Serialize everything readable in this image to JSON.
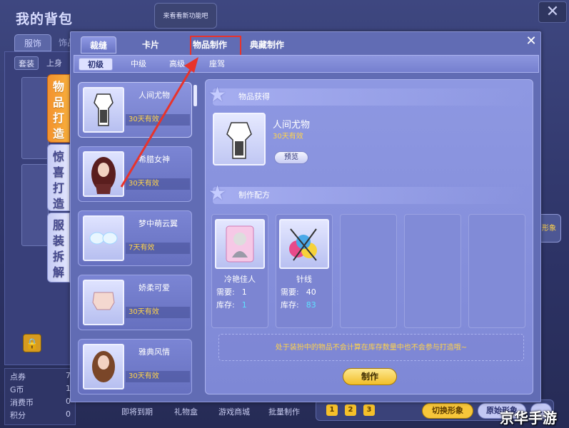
{
  "bag": {
    "title": "我的背包",
    "top_banner": "来看看新功能吧",
    "close": "✕",
    "tabs": [
      "服饰",
      "饰品"
    ],
    "subtabs": [
      "套装",
      "上身"
    ],
    "lock_icon": "lock-icon",
    "stats": [
      {
        "label": "点券",
        "value": "7"
      },
      {
        "label": "G币",
        "value": "1"
      },
      {
        "label": "消费币",
        "value": "0"
      },
      {
        "label": "积分",
        "value": "0"
      }
    ],
    "bottom_links": [
      "即将到期",
      "礼物盒",
      "游戏商城",
      "批量制作"
    ],
    "side_button": "形象",
    "toolbar": {
      "slots": [
        "1",
        "2",
        "3"
      ],
      "switch": "切换形象",
      "origin": "原始形象",
      "more": "…"
    }
  },
  "vertical_tabs": [
    {
      "label": "物品打造",
      "active": true
    },
    {
      "label": "惊喜打造",
      "active": false
    },
    {
      "label": "服装拆解",
      "active": false
    }
  ],
  "craft": {
    "close": "✕",
    "tabs": [
      "裁缝",
      "卡片",
      "物品制作",
      "典藏制作"
    ],
    "active_tab": "裁缝",
    "highlighted_tab": "物品制作",
    "levels": [
      "初级",
      "中级",
      "高级",
      "座驾"
    ],
    "active_level": "初级",
    "list": [
      {
        "name": "人间尤物",
        "validity": "30天有效",
        "selected": true
      },
      {
        "name": "希腊女神",
        "validity": "30天有效"
      },
      {
        "name": "梦中萌云翼",
        "validity": "7天有效"
      },
      {
        "name": "娇柔可爱",
        "validity": "30天有效"
      },
      {
        "name": "雅典风情",
        "validity": "30天有效"
      }
    ],
    "obtain_heading": "物品获得",
    "product": {
      "name": "人间尤物",
      "validity": "30天有效",
      "preview": "预览"
    },
    "recipe_heading": "制作配方",
    "materials": [
      {
        "name": "冷艳佳人",
        "need_label": "需要:",
        "need": "1",
        "stock_label": "库存:",
        "stock": "1"
      },
      {
        "name": "针线",
        "need_label": "需要:",
        "need": "40",
        "stock_label": "库存:",
        "stock": "83"
      }
    ],
    "note": "处于装扮中的物品不会计算在库存数量中也不会参与打造哦~",
    "make": "制作"
  },
  "watermark": "京华手游",
  "colors": {
    "accent_orange": "#f3922e",
    "highlight_red": "#e8332b",
    "gold_text": "#ffd34a",
    "stock_cyan": "#5ee0ff"
  }
}
